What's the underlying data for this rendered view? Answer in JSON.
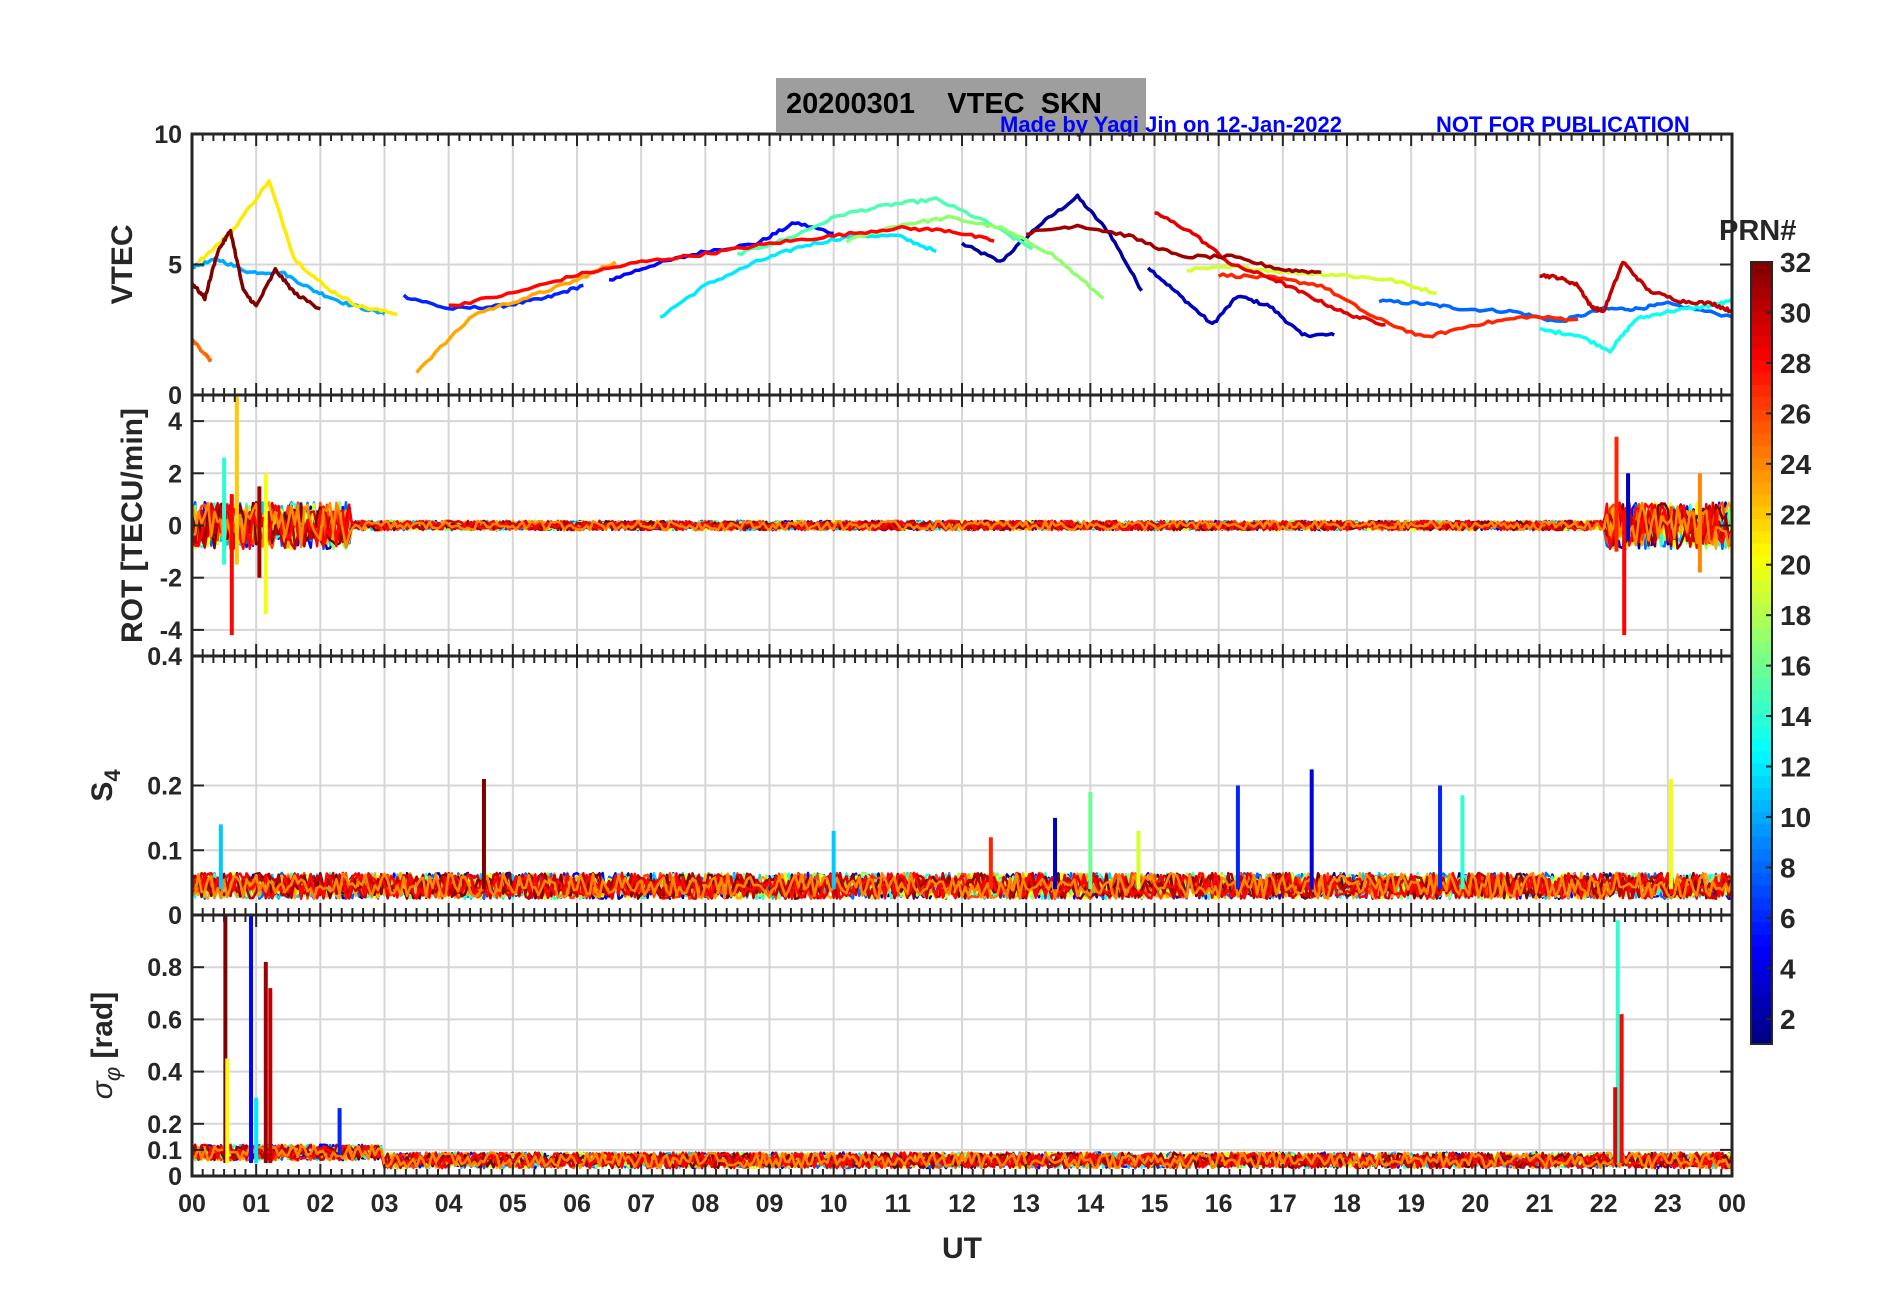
{
  "header": {
    "title": "20200301    VTEC  SKN",
    "credit": "Made by Yaqi Jin on 12-Jan-2022",
    "notice": "NOT FOR PUBLICATION"
  },
  "chart_data": {
    "type": "line",
    "xlabel": "UT",
    "xlim": [
      0,
      24
    ],
    "x_ticks": [
      "00",
      "01",
      "02",
      "03",
      "04",
      "05",
      "06",
      "07",
      "08",
      "09",
      "10",
      "11",
      "12",
      "13",
      "14",
      "15",
      "16",
      "17",
      "18",
      "19",
      "20",
      "21",
      "22",
      "23",
      "00"
    ],
    "colorbar": {
      "label": "PRN#",
      "colormap": "jet",
      "range": [
        1,
        32
      ],
      "ticks": [
        "2",
        "4",
        "6",
        "8",
        "10",
        "12",
        "14",
        "16",
        "18",
        "20",
        "22",
        "24",
        "26",
        "28",
        "30",
        "32"
      ],
      "tick_values": [
        2,
        4,
        6,
        8,
        10,
        12,
        14,
        16,
        18,
        20,
        22,
        24,
        26,
        28,
        30,
        32
      ]
    },
    "panels": [
      {
        "id": "vtec",
        "ylabel": "VTEC",
        "ylim": [
          0,
          10
        ],
        "y_ticks": [
          0,
          5,
          10
        ],
        "y_tick_labels": [
          "0",
          "5",
          "10"
        ],
        "series": [
          {
            "prn": 2,
            "x": [
              12.0,
              12.6,
              13.2,
              13.8,
              14.3,
              14.8
            ],
            "y": [
              5.8,
              5.1,
              6.5,
              7.6,
              6.2,
              4.0
            ]
          },
          {
            "prn": 3,
            "x": [
              14.9,
              15.4,
              15.9,
              16.3,
              16.8,
              17.3,
              17.8
            ],
            "y": [
              4.9,
              3.8,
              2.7,
              3.8,
              3.4,
              2.3,
              2.3
            ]
          },
          {
            "prn": 5,
            "x": [
              6.5,
              7.2,
              8.0,
              8.8,
              9.4,
              10.0
            ],
            "y": [
              4.4,
              5.0,
              5.5,
              5.8,
              6.6,
              6.2
            ]
          },
          {
            "prn": 6,
            "x": [
              3.3,
              4.0,
              4.8,
              5.5,
              6.1
            ],
            "y": [
              3.8,
              3.3,
              3.4,
              3.7,
              4.2
            ]
          },
          {
            "prn": 8,
            "x": [
              18.5,
              19.2,
              19.8,
              20.6,
              21.3,
              22.0,
              22.5,
              23.0,
              24.0
            ],
            "y": [
              3.6,
              3.5,
              3.3,
              3.2,
              2.8,
              3.3,
              3.3,
              3.5,
              3.0
            ]
          },
          {
            "prn": 10,
            "x": [
              0.0,
              0.4,
              0.9,
              1.4,
              1.9,
              2.4,
              3.0
            ],
            "y": [
              4.9,
              5.2,
              4.7,
              4.7,
              4.0,
              3.5,
              3.1
            ]
          },
          {
            "prn": 12,
            "x": [
              7.3,
              8.0,
              8.8,
              9.5,
              10.3,
              11.0,
              11.6
            ],
            "y": [
              3.0,
              4.2,
              5.1,
              5.7,
              6.1,
              6.1,
              5.5
            ]
          },
          {
            "prn": 13,
            "x": [
              21.0,
              21.6,
              22.1,
              22.5,
              23.0,
              23.6,
              24.0
            ],
            "y": [
              2.5,
              2.3,
              1.7,
              2.9,
              3.2,
              3.4,
              3.6
            ]
          },
          {
            "prn": 15,
            "x": [
              8.5,
              9.3,
              10.1,
              10.9,
              11.6,
              12.4,
              13.1
            ],
            "y": [
              5.4,
              6.0,
              6.9,
              7.3,
              7.5,
              6.6,
              5.6
            ]
          },
          {
            "prn": 17,
            "x": [
              10.2,
              11.0,
              11.8,
              12.6,
              13.4,
              14.2
            ],
            "y": [
              5.9,
              6.5,
              6.8,
              6.4,
              5.4,
              3.7
            ]
          },
          {
            "prn": 19,
            "x": [
              15.5,
              16.3,
              17.1,
              17.9,
              18.7,
              19.4
            ],
            "y": [
              4.8,
              4.9,
              4.7,
              4.6,
              4.4,
              3.9
            ]
          },
          {
            "prn": 21,
            "x": [
              0.1,
              0.6,
              1.2,
              1.6,
              2.1,
              2.6,
              3.2
            ],
            "y": [
              5.1,
              6.2,
              8.2,
              5.2,
              4.1,
              3.4,
              3.1
            ]
          },
          {
            "prn": 23,
            "x": [
              3.5,
              4.4,
              5.3,
              6.0,
              6.6
            ],
            "y": [
              0.9,
              3.1,
              3.8,
              4.4,
              5.1
            ]
          },
          {
            "prn": 25,
            "x": [
              0.0,
              0.2,
              0.3
            ],
            "y": [
              2.1,
              1.6,
              1.3
            ]
          },
          {
            "prn": 27,
            "x": [
              16.0,
              16.8,
              17.6,
              18.4,
              19.2,
              20.0,
              20.8,
              21.6
            ],
            "y": [
              4.6,
              4.5,
              4.2,
              3.0,
              2.2,
              2.7,
              3.0,
              2.9
            ]
          },
          {
            "prn": 28,
            "x": [
              4.0,
              5.0,
              6.0,
              7.0,
              8.0,
              9.0,
              10.0,
              11.0,
              11.8,
              12.5
            ],
            "y": [
              3.4,
              3.9,
              4.6,
              5.1,
              5.4,
              5.8,
              6.1,
              6.4,
              6.3,
              5.9
            ]
          },
          {
            "prn": 29,
            "x": [
              15.0,
              15.6,
              16.2,
              16.8,
              17.4,
              18.0,
              18.6
            ],
            "y": [
              7.0,
              6.2,
              5.0,
              4.5,
              3.8,
              3.1,
              2.7
            ]
          },
          {
            "prn": 30,
            "x": [
              21.0,
              21.3,
              21.6,
              21.8,
              22.0,
              22.3,
              22.7,
              23.2,
              23.7,
              24.0
            ],
            "y": [
              4.6,
              4.5,
              4.2,
              3.4,
              3.2,
              5.1,
              4.0,
              3.6,
              3.5,
              3.2
            ]
          },
          {
            "prn": 31,
            "x": [
              13.0,
              13.8,
              14.6,
              15.4,
              16.2,
              17.0,
              17.6
            ],
            "y": [
              6.2,
              6.5,
              6.1,
              5.3,
              5.3,
              4.8,
              4.7
            ]
          },
          {
            "prn": 32,
            "x": [
              0.0,
              0.2,
              0.4,
              0.6,
              0.8,
              1.0,
              1.3,
              1.6,
              2.0
            ],
            "y": [
              4.3,
              3.7,
              5.5,
              6.3,
              4.0,
              3.4,
              4.8,
              3.9,
              3.3
            ]
          }
        ]
      },
      {
        "id": "rot",
        "ylabel": "ROT [TECU/min]",
        "ylim": [
          -5,
          5
        ],
        "y_ticks": [
          -4,
          -2,
          0,
          2,
          4
        ],
        "y_tick_labels": [
          "-4",
          "-2",
          "0",
          "2",
          "4"
        ],
        "spikes": [
          {
            "prn": 22,
            "x": 0.7,
            "lo": -1.5,
            "hi": 5.0
          },
          {
            "prn": 28,
            "x": 0.62,
            "lo": -4.2,
            "hi": 1.2
          },
          {
            "prn": 20,
            "x": 1.15,
            "lo": -3.4,
            "hi": 2.0
          },
          {
            "prn": 31,
            "x": 1.05,
            "lo": -2.0,
            "hi": 1.5
          },
          {
            "prn": 14,
            "x": 0.5,
            "lo": -1.5,
            "hi": 2.6
          },
          {
            "prn": 27,
            "x": 22.2,
            "lo": -1.0,
            "hi": 3.4
          },
          {
            "prn": 28,
            "x": 22.32,
            "lo": -4.2,
            "hi": 0.6
          },
          {
            "prn": 3,
            "x": 22.38,
            "lo": -0.6,
            "hi": 2.0
          },
          {
            "prn": 24,
            "x": 23.5,
            "lo": -1.8,
            "hi": 2.0
          }
        ]
      },
      {
        "id": "s4",
        "ylabel": "S4",
        "ylim": [
          0,
          0.4
        ],
        "y_ticks": [
          0,
          0.1,
          0.2,
          0.4
        ],
        "y_tick_labels": [
          "0",
          "0.1",
          "0.2",
          "0.4"
        ],
        "spikes": [
          {
            "prn": 32,
            "x": 4.55,
            "lo": 0.04,
            "hi": 0.21
          },
          {
            "prn": 11,
            "x": 0.45,
            "lo": 0.04,
            "hi": 0.14
          },
          {
            "prn": 27,
            "x": 12.45,
            "lo": 0.04,
            "hi": 0.12
          },
          {
            "prn": 3,
            "x": 13.45,
            "lo": 0.04,
            "hi": 0.15
          },
          {
            "prn": 16,
            "x": 14.0,
            "lo": 0.04,
            "hi": 0.19
          },
          {
            "prn": 19,
            "x": 14.75,
            "lo": 0.04,
            "hi": 0.13
          },
          {
            "prn": 6,
            "x": 16.3,
            "lo": 0.04,
            "hi": 0.2
          },
          {
            "prn": 4,
            "x": 17.45,
            "lo": 0.04,
            "hi": 0.225
          },
          {
            "prn": 6,
            "x": 19.45,
            "lo": 0.04,
            "hi": 0.2
          },
          {
            "prn": 14,
            "x": 19.8,
            "lo": 0.04,
            "hi": 0.185
          },
          {
            "prn": 20,
            "x": 23.05,
            "lo": 0.04,
            "hi": 0.21
          },
          {
            "prn": 11,
            "x": 10.0,
            "lo": 0.04,
            "hi": 0.13
          }
        ]
      },
      {
        "id": "sigma_phi",
        "ylabel": "σφ [rad]",
        "ylim": [
          0,
          1.0
        ],
        "y_ticks": [
          0,
          0.1,
          0.2,
          0.4,
          0.6,
          0.8
        ],
        "y_tick_labels": [
          "0",
          "0.1",
          "0.2",
          "0.4",
          "0.6",
          "0.8"
        ],
        "spikes": [
          {
            "prn": 32,
            "x": 0.52,
            "lo": 0.05,
            "hi": 1.0
          },
          {
            "prn": 20,
            "x": 0.55,
            "lo": 0.05,
            "hi": 0.45
          },
          {
            "prn": 5,
            "x": 0.92,
            "lo": 0.05,
            "hi": 1.0
          },
          {
            "prn": 12,
            "x": 1.0,
            "lo": 0.05,
            "hi": 0.3
          },
          {
            "prn": 31,
            "x": 1.15,
            "lo": 0.05,
            "hi": 0.82
          },
          {
            "prn": 30,
            "x": 1.22,
            "lo": 0.05,
            "hi": 0.72
          },
          {
            "prn": 6,
            "x": 2.3,
            "lo": 0.08,
            "hi": 0.26
          },
          {
            "prn": 14,
            "x": 22.22,
            "lo": 0.05,
            "hi": 0.98
          },
          {
            "prn": 28,
            "x": 22.28,
            "lo": 0.05,
            "hi": 0.62
          },
          {
            "prn": 29,
            "x": 22.18,
            "lo": 0.05,
            "hi": 0.34
          }
        ]
      }
    ]
  }
}
